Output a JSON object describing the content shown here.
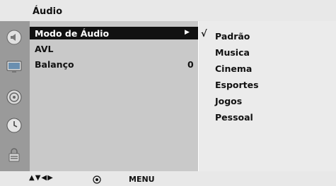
{
  "header": {
    "title": "Áudio"
  },
  "sidebar": {
    "icons": [
      "sound-icon",
      "picture-icon",
      "setup-disc-icon",
      "time-clock-icon",
      "lock-icon"
    ]
  },
  "menu": {
    "items": [
      {
        "label": "Modo de Áudio",
        "value": "",
        "selected": true,
        "has_submenu": true
      },
      {
        "label": "AVL",
        "value": "",
        "selected": false
      },
      {
        "label": "Balanço",
        "value": "0",
        "selected": false
      }
    ]
  },
  "submenu": {
    "check_mark": "√",
    "options": [
      "Padrão",
      "Musica",
      "Cinema",
      "Esportes",
      "Jogos",
      "Pessoal"
    ],
    "selected_index": 0
  },
  "footer": {
    "nav_keys": "▲▼◀▶",
    "ok_icon": "ok-button-icon",
    "menu_label": "MENU"
  },
  "colors": {
    "selection": "#111111",
    "panel_left": "#c9c9c9",
    "panel_right": "#ebebeb",
    "sidebar": "#9a9a9a"
  }
}
